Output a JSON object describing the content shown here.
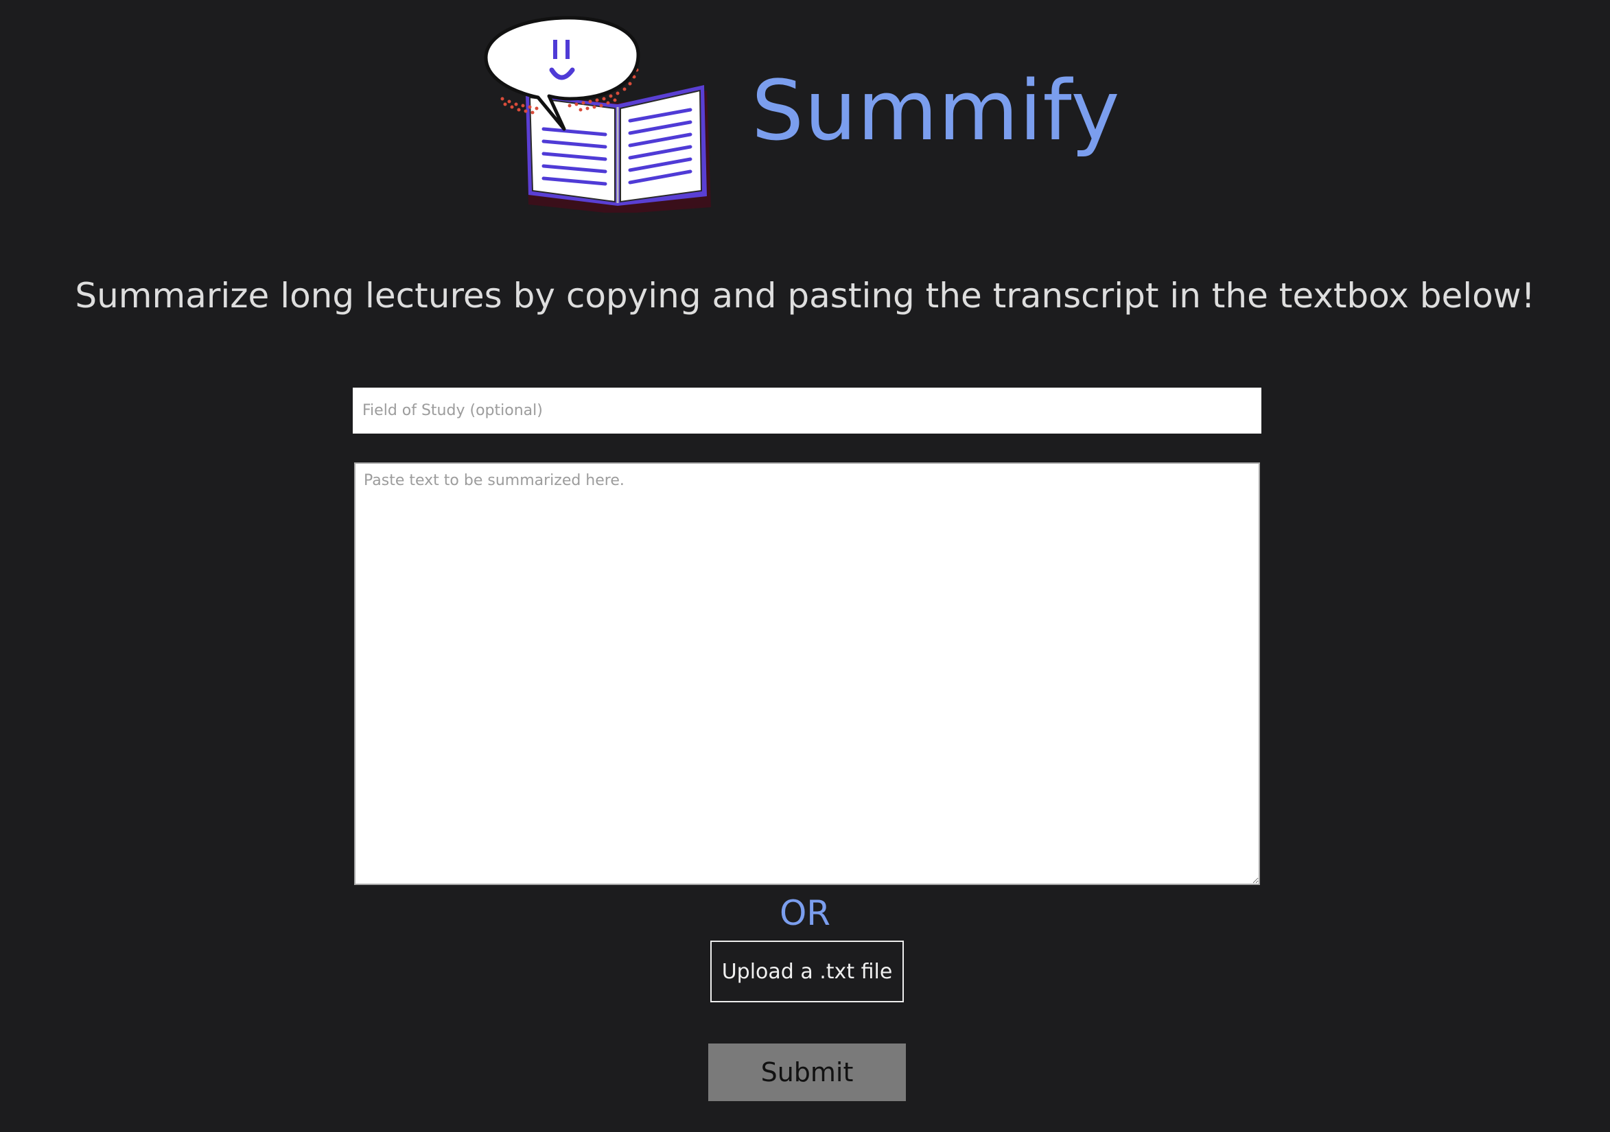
{
  "header": {
    "title": "Summify",
    "logo_icon": "book-speech-bubble-smiley-logo"
  },
  "tagline": "Summarize long lectures by copying and pasting the transcript in the textbox below!",
  "form": {
    "field_of_study": {
      "placeholder": "Field of Study (optional)",
      "value": ""
    },
    "transcript": {
      "placeholder": "Paste text to be summarized here.",
      "value": ""
    },
    "or_label": "OR",
    "upload_label": "Upload a .txt file",
    "submit_label": "Submit"
  },
  "colors": {
    "background": "#1c1c1e",
    "accent": "#7b9eee",
    "logo_purple": "#4f3bd6",
    "logo_red": "#d94c3a",
    "submit_bg": "#7a7a7a"
  }
}
